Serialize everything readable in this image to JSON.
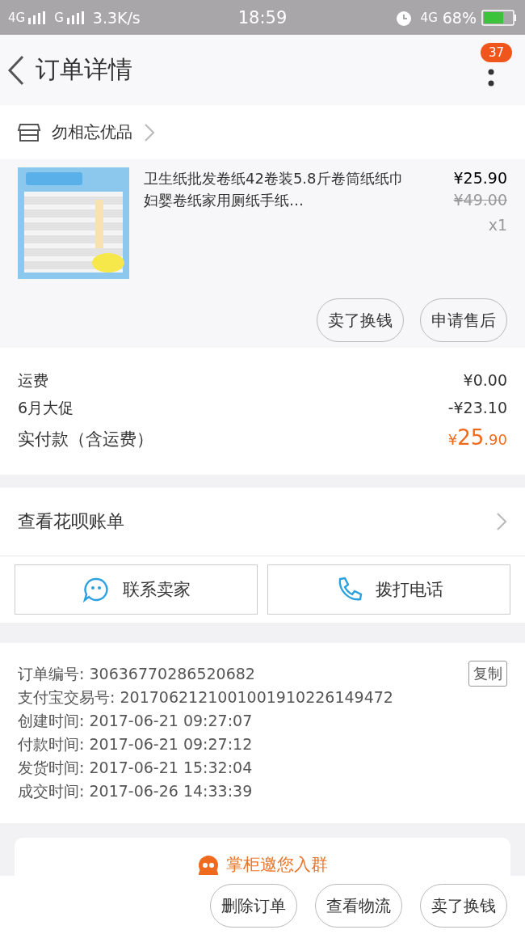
{
  "status_bar": {
    "network_1": "4G",
    "network_2": "G",
    "speed": "3.3K/s",
    "time": "18:59",
    "network_3": "4G",
    "battery_percent": "68%"
  },
  "header": {
    "title": "订单详情",
    "badge": "37"
  },
  "shop": {
    "name": "勿相忘优品"
  },
  "product": {
    "image": {
      "kind": "picture"
    },
    "title": "卫生纸批发卷纸42卷装5.8斤卷筒纸纸巾妇婴卷纸家用厕纸手纸…",
    "price": "¥25.90",
    "original_price": "¥49.00",
    "quantity": "x1",
    "actions": [
      "卖了换钱",
      "申请售后"
    ]
  },
  "fees": [
    {
      "label": "运费",
      "value": "¥0.00",
      "kind": "plain"
    },
    {
      "label": "6月大促",
      "value": "-¥23.10",
      "kind": "plain"
    },
    {
      "label": "实付款（含运费）",
      "currency": "¥",
      "value_main": "25",
      "value_decimal": ".90",
      "kind": "total"
    }
  ],
  "huabei": {
    "label": "查看花呗账单"
  },
  "contact": [
    {
      "label": "联系卖家",
      "kind": "chat"
    },
    {
      "label": "拨打电话",
      "kind": "phone"
    }
  ],
  "order_info": {
    "copy_button": "复制",
    "lines": [
      {
        "label": "订单编号:",
        "value": "30636770286520682"
      },
      {
        "label": "支付宝交易号:",
        "value": "2017062121001001910226149472"
      },
      {
        "label": "创建时间:",
        "value": "2017-06-21 09:27:07"
      },
      {
        "label": "付款时间:",
        "value": "2017-06-21 09:27:12"
      },
      {
        "label": "发货时间:",
        "value": "2017-06-21 15:32:04"
      },
      {
        "label": "成交时间:",
        "value": "2017-06-26 14:33:39"
      }
    ]
  },
  "group_card": {
    "text": "掌柜邀您入群"
  },
  "bottom_actions": [
    "删除订单",
    "查看物流",
    "卖了换钱"
  ]
}
